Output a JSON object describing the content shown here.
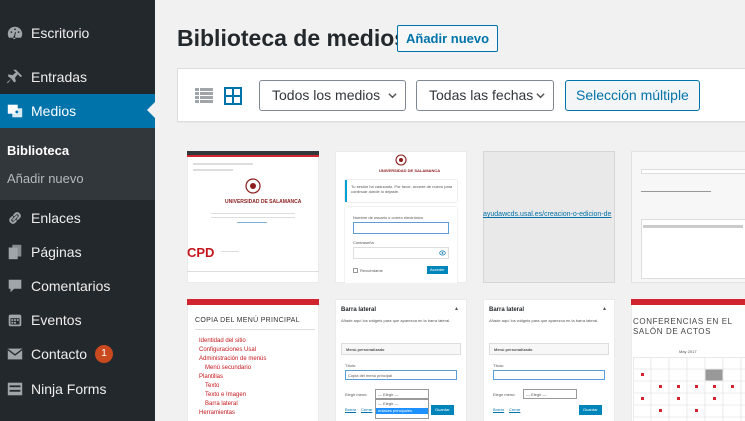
{
  "sidebar": {
    "items": [
      {
        "label": "Escritorio",
        "icon": "dashboard-icon"
      },
      {
        "label": "Entradas",
        "icon": "pin-icon"
      },
      {
        "label": "Medios",
        "icon": "media-icon"
      },
      {
        "label": "Enlaces",
        "icon": "link-icon"
      },
      {
        "label": "Páginas",
        "icon": "pages-icon"
      },
      {
        "label": "Comentarios",
        "icon": "comment-icon"
      },
      {
        "label": "Eventos",
        "icon": "calendar-icon"
      },
      {
        "label": "Contacto",
        "icon": "mail-icon",
        "badge": "1"
      },
      {
        "label": "Ninja Forms",
        "icon": "forms-icon"
      }
    ],
    "submenu": [
      {
        "label": "Biblioteca"
      },
      {
        "label": "Añadir nuevo"
      }
    ]
  },
  "header": {
    "title": "Biblioteca de medios",
    "add_new": "Añadir nuevo"
  },
  "toolbar": {
    "filter_type": "Todos los medios",
    "filter_date": "Todas las fechas",
    "bulk_select": "Selección múltiple"
  },
  "thumbs": {
    "t1": {
      "heading": "UNIVERSIDAD DE SALAMANCA",
      "cpd": "CPD"
    },
    "t2": {
      "heading": "UNIVERSIDAD DE SALAMANCA",
      "notice": "Tu sesión ha caducado. Por favor, accede de nuevo para continuar donde lo dejaste.",
      "user_label": "Nombre de usuario o correo electrónico",
      "pass_label": "Contraseña",
      "remember": "Recuérdame",
      "login": "Acceder"
    },
    "t3": {
      "url": "ayudawcds.usal.es/creacion-o-edicion-de"
    },
    "t5": {
      "title": "COPIA DEL MENÚ PRINCIPAL",
      "items": [
        "Identidad del sitio",
        "Configuraciones Usal",
        "Administración de menús",
        "Menú secundario",
        "Plantillas",
        "Texto",
        "Texto e Imagen",
        "Barra lateral",
        "Herramientas"
      ]
    },
    "t6": {
      "panel_title": "Barra lateral",
      "desc": "Añade aquí los widgets para que aparezca en la barra lateral.",
      "widget": "Menú personalizado",
      "title_label": "Título:",
      "title_value": "Copia del menú principal",
      "menu_label": "Elegir menú:",
      "menu_value": "— Elegir —",
      "opt1": "— Elegir —",
      "opt2": "enlaces principales",
      "delete": "Borrar",
      "close": "Cerrar",
      "save": "Guardar"
    },
    "t7": {
      "panel_title": "Barra lateral",
      "desc": "Añade aquí los widgets para que aparezca en la barra lateral.",
      "widget": "Menú personalizado",
      "title_label": "Título:",
      "menu_label": "Elegir menú:",
      "menu_value": "— Elegir —",
      "delete": "Borrar",
      "close": "Cerrar",
      "save": "Guardar"
    },
    "t8": {
      "title": "CONFERENCIAS EN EL SALÓN DE ACTOS",
      "month": "May 2017"
    }
  }
}
